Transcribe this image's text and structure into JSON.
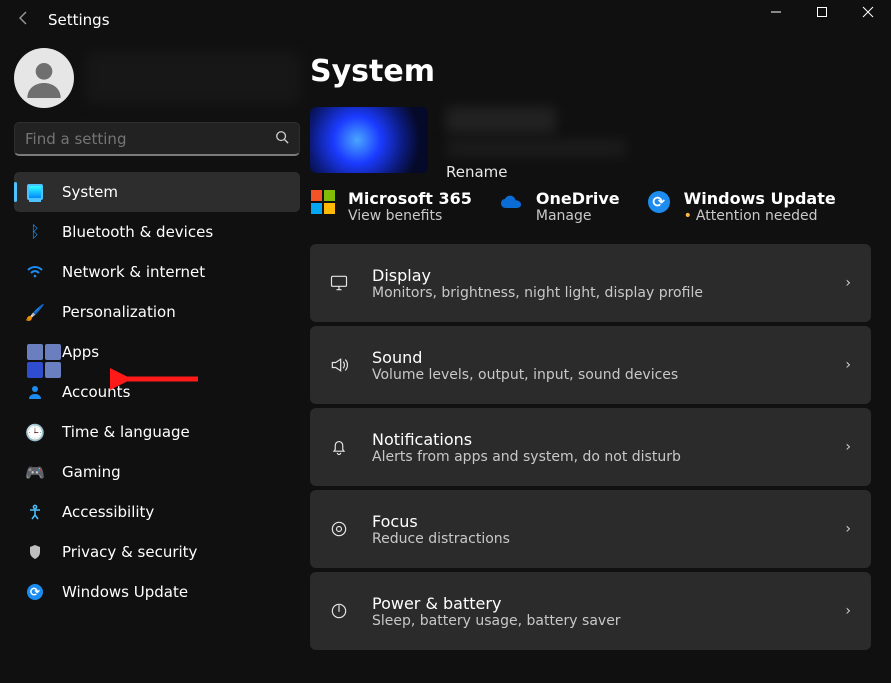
{
  "window": {
    "title": "Settings"
  },
  "search": {
    "placeholder": "Find a setting"
  },
  "sidebar": {
    "items": [
      {
        "label": "System"
      },
      {
        "label": "Bluetooth & devices"
      },
      {
        "label": "Network & internet"
      },
      {
        "label": "Personalization"
      },
      {
        "label": "Apps"
      },
      {
        "label": "Accounts"
      },
      {
        "label": "Time & language"
      },
      {
        "label": "Gaming"
      },
      {
        "label": "Accessibility"
      },
      {
        "label": "Privacy & security"
      },
      {
        "label": "Windows Update"
      }
    ]
  },
  "page": {
    "heading": "System",
    "rename": "Rename"
  },
  "cloud": {
    "m365": {
      "title": "Microsoft 365",
      "sub": "View benefits"
    },
    "onedrive": {
      "title": "OneDrive",
      "sub": "Manage"
    },
    "winupd": {
      "title": "Windows Update",
      "sub": "Attention needed"
    }
  },
  "list": [
    {
      "title": "Display",
      "sub": "Monitors, brightness, night light, display profile"
    },
    {
      "title": "Sound",
      "sub": "Volume levels, output, input, sound devices"
    },
    {
      "title": "Notifications",
      "sub": "Alerts from apps and system, do not disturb"
    },
    {
      "title": "Focus",
      "sub": "Reduce distractions"
    },
    {
      "title": "Power & battery",
      "sub": "Sleep, battery usage, battery saver"
    }
  ]
}
